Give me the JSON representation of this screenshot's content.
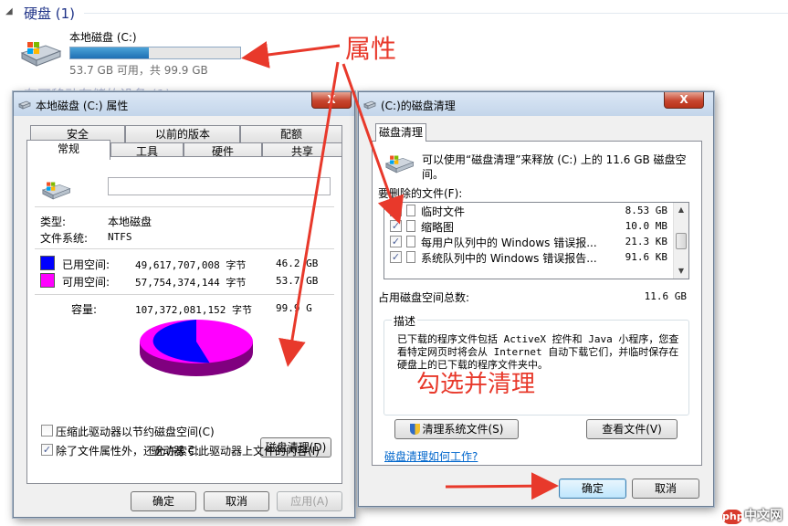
{
  "explorer": {
    "section_title": "硬盘 (1)",
    "drive_name": "本地磁盘 (C:)",
    "drive_used_fraction": 0.46,
    "drive_free_text": "53.7 GB 可用，共 99.9 GB"
  },
  "properties": {
    "title": "本地磁盘 (C:) 属性",
    "close": "X",
    "tabs_row1": [
      "安全",
      "以前的版本",
      "配额"
    ],
    "tabs_row2": [
      "常规",
      "工具",
      "硬件",
      "共享"
    ],
    "type_label": "类型:",
    "type_value": "本地磁盘",
    "fs_label": "文件系统:",
    "fs_value": "NTFS",
    "used_label": "已用空间:",
    "used_bytes": "49,617,707,008 字节",
    "used_gb": "46.2 GB",
    "free_label": "可用空间:",
    "free_bytes": "57,754,374,144 字节",
    "free_gb": "53.7 GB",
    "capacity_label": "容量:",
    "capacity_bytes": "107,372,081,152 字节",
    "capacity_gb": "99.9 G",
    "drive_label": "驱动器 C:",
    "cleanup_button": "磁盘清理(D)",
    "compress_label": "压缩此驱动器以节约磁盘空间(C)",
    "index_label": "除了文件属性外，还允许索引此驱动器上文件的内容(I)",
    "ok": "确定",
    "cancel": "取消",
    "apply": "应用(A)",
    "used_color": "#0000ff",
    "free_color": "#ff00ff"
  },
  "cleanup": {
    "title": "(C:)的磁盘清理",
    "close": "X",
    "tab": "磁盘清理",
    "intro": "可以使用“磁盘清理”来释放  (C:) 上的 11.6 GB 磁盘空间。",
    "files_label": "要删除的文件(F):",
    "files": [
      {
        "name": "临时文件",
        "size": "8.53 GB",
        "checked": true
      },
      {
        "name": "缩略图",
        "size": "10.0 MB",
        "checked": true
      },
      {
        "name": "每用户队列中的 Windows 错误报...",
        "size": "21.3 KB",
        "checked": true
      },
      {
        "name": "系统队列中的 Windows 错误报告...",
        "size": "91.6 KB",
        "checked": true
      }
    ],
    "total_label": "占用磁盘空间总数:",
    "total_value": "11.6 GB",
    "desc_legend": "描述",
    "desc_text": "已下载的程序文件包括 ActiveX 控件和 Java 小程序，您查看特定网页时将会从 Internet 自动下载它们，并临时保存在硬盘上的已下载的程序文件夹中。",
    "clean_system_button": "清理系统文件(S)",
    "view_files_button": "查看文件(V)",
    "help_link": "磁盘清理如何工作?",
    "ok": "确定",
    "cancel": "取消"
  },
  "annotations": {
    "properties_note": "属性",
    "select_clean_note": "勾选并清理",
    "color": "#e8392b"
  },
  "watermark": {
    "logo": "php",
    "text": "中文网"
  }
}
